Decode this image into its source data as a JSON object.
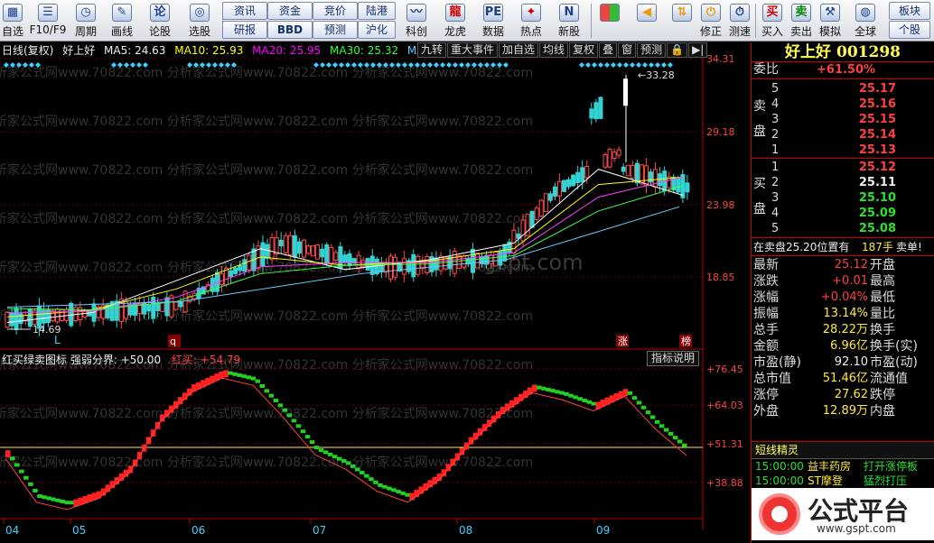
{
  "toolbar": {
    "row1": [
      "自选",
      "F10/F9",
      "周期",
      "画线",
      "论股",
      "选股"
    ],
    "row1b": [
      "资讯",
      "资金",
      "竞价",
      "陆港"
    ],
    "row2b": [
      "研报",
      "BBD",
      "预测",
      "沪化"
    ],
    "row3": [
      "科创",
      "龙虎",
      "数据",
      "热点",
      "新股"
    ],
    "row4": [
      "修正",
      "测速",
      "买入",
      "卖出",
      "模拟",
      "全球"
    ],
    "corner": [
      "板块",
      "个股"
    ]
  },
  "chart_header": {
    "title": "日线(复权)",
    "name": "好上好",
    "ma5": "MA5: 24.63",
    "ma10": "MA10: 25.93",
    "ma20": "MA20: 25.95",
    "ma30": "MA30: 25.32",
    "ma60": "MA6",
    "buttons": [
      "九转",
      "重大事件",
      "加自选",
      "均线",
      "复权",
      "叠",
      "窗",
      "预测"
    ]
  },
  "price_axis": [
    "34.31",
    "29.18",
    "23.98",
    "18.85"
  ],
  "high_label": "33.28",
  "low_label": "14.69",
  "markers": [
    "L",
    "q",
    "涨",
    "榜"
  ],
  "watermark": "分析家公式网www.70822.com",
  "watermark2": "www.gspt.com",
  "indicator": {
    "title": "红买绿卖图标 强弱分界: +50.00",
    "buy": "红买: +54.79",
    "button": "指标说明",
    "axis": [
      "76.45",
      "64.03",
      "51.31",
      "38.88"
    ]
  },
  "months": [
    "04",
    "05",
    "06",
    "07",
    "08",
    "09"
  ],
  "panel": {
    "name": "好上好",
    "code": "001298",
    "weibi_label": "委比",
    "weibi": "+61.50%",
    "sell_label": [
      "卖",
      "盘"
    ],
    "buy_label": [
      "买",
      "盘"
    ],
    "sells": [
      [
        "5",
        "25.17"
      ],
      [
        "4",
        "25.16"
      ],
      [
        "3",
        "25.15"
      ],
      [
        "2",
        "25.14"
      ],
      [
        "1",
        "25.13"
      ]
    ],
    "buys": [
      [
        "1",
        "25.12"
      ],
      [
        "2",
        "25.11"
      ],
      [
        "3",
        "25.10"
      ],
      [
        "4",
        "25.09"
      ],
      [
        "5",
        "25.08"
      ]
    ],
    "trade_note": "在卖盘25.20位置有",
    "trade_qty": "187手",
    "trade_tag": "卖单!",
    "quotes": [
      [
        "最新",
        "25.12",
        "开盘"
      ],
      [
        "涨跌",
        "+0.01",
        "最高"
      ],
      [
        "涨幅",
        "+0.04%",
        "最低"
      ],
      [
        "振幅",
        "13.14%",
        "量比"
      ],
      [
        "总手",
        "28.22万",
        "换手"
      ],
      [
        "金额",
        "6.96亿",
        "换手(实)"
      ],
      [
        "市盈(静)",
        "92.10",
        "市盈(动)"
      ],
      [
        "总市值",
        "51.46亿",
        "流通值"
      ],
      [
        "涨停",
        "27.62",
        "跌停"
      ],
      [
        "外盘",
        "12.89万",
        "内盘"
      ]
    ],
    "shortline_title": "短线精灵",
    "shortline": [
      [
        "15:00:00",
        "益丰药房",
        "打开涨停板"
      ],
      [
        "15:00:00",
        "ST摩登",
        "猛烈打压"
      ]
    ],
    "logo_text": "公式平台",
    "logo_url": "www.gspt.com"
  },
  "chart_data": {
    "type": "line",
    "title": "",
    "x": [
      "04",
      "05",
      "06",
      "07",
      "08",
      "09"
    ],
    "ylim": [
      14.69,
      34.31
    ],
    "series": [
      {
        "name": "MA5",
        "values": [
          15.5,
          16.2,
          18.5,
          20.8,
          19.3,
          20.0,
          21.2,
          26.5,
          24.63
        ]
      },
      {
        "name": "MA10",
        "values": [
          15.9,
          16.4,
          17.9,
          20.2,
          19.6,
          19.9,
          20.8,
          25.4,
          25.93
        ]
      },
      {
        "name": "MA20",
        "values": [
          16.2,
          16.3,
          17.3,
          19.5,
          19.8,
          19.8,
          20.5,
          24.5,
          25.95
        ]
      },
      {
        "name": "MA30",
        "values": [
          16.5,
          16.4,
          17.0,
          19.0,
          19.6,
          19.7,
          20.3,
          23.5,
          25.32
        ]
      }
    ],
    "indicator_values": [
      54,
      42,
      40,
      43,
      50,
      64,
      72,
      76,
      74,
      65,
      55,
      51,
      45,
      42,
      48,
      58,
      66,
      72,
      70,
      67,
      71,
      62,
      54.79
    ]
  }
}
